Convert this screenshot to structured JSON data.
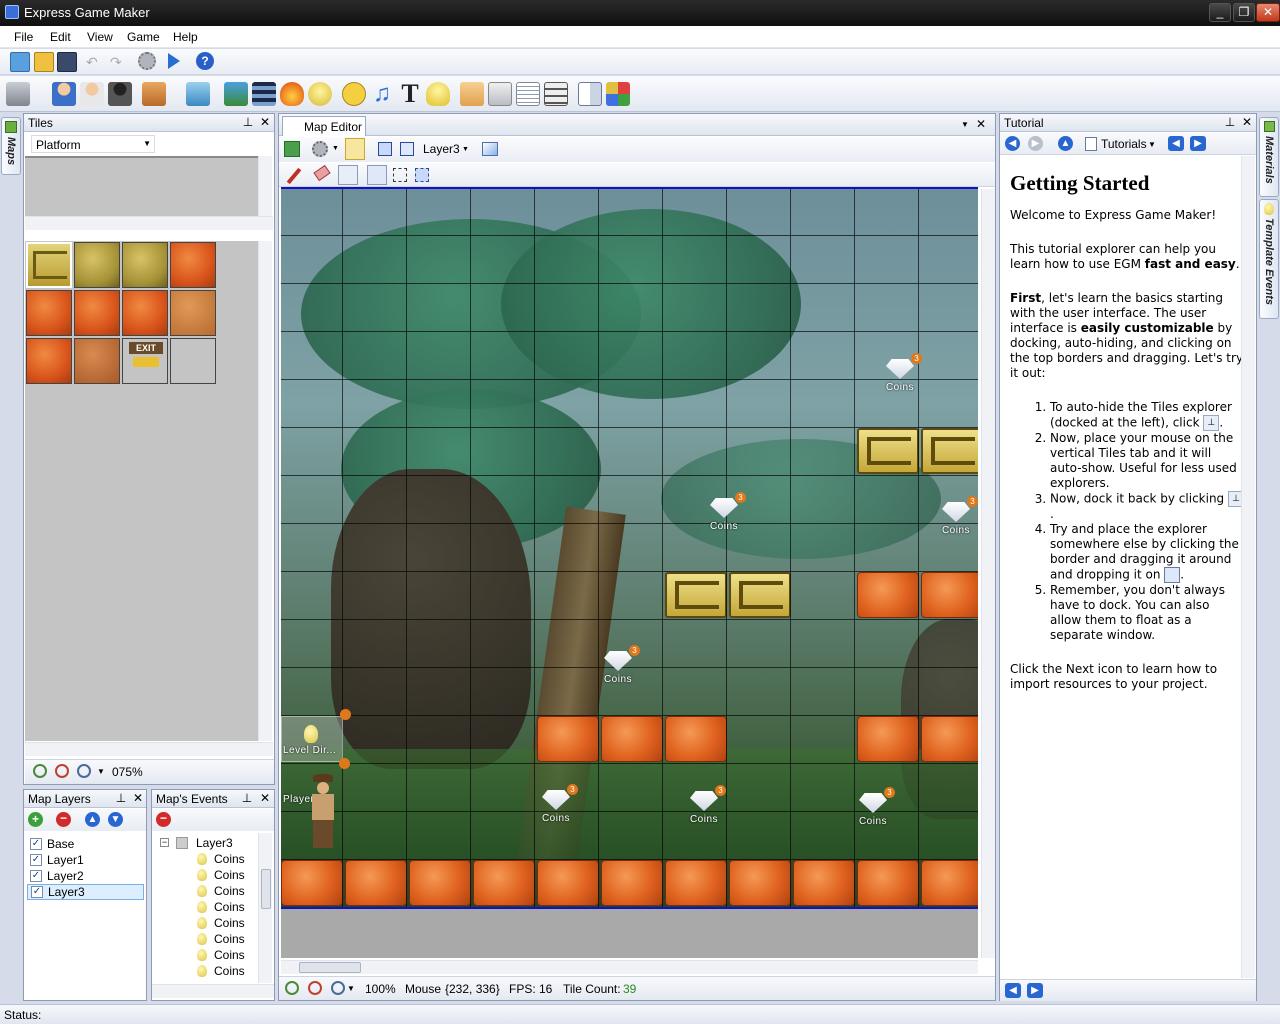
{
  "window": {
    "title": "Express Game Maker"
  },
  "menu": [
    "File",
    "Edit",
    "View",
    "Game",
    "Help"
  ],
  "tiles_panel": {
    "title": "Tiles",
    "tileset_select": "Platform",
    "zoom": "075%"
  },
  "left_tab": {
    "label": "Maps"
  },
  "map_layers": {
    "title": "Map Layers",
    "layers": [
      "Base",
      "Layer1",
      "Layer2",
      "Layer3"
    ]
  },
  "map_events": {
    "title": "Map's Events",
    "root": "Layer3",
    "items": [
      "Coins",
      "Coins",
      "Coins",
      "Coins",
      "Coins",
      "Coins",
      "Coins",
      "Coins"
    ]
  },
  "map_editor": {
    "tab": "Map Editor",
    "layer_select": "Layer3",
    "coin_label": "Coins",
    "coin_badge": "3",
    "level_dir_label": "Level Dir...",
    "player_label": "Player",
    "tile_label": "EXIT",
    "status": {
      "zoom": "100%",
      "mouse_label": "Mouse",
      "mouse_value": "{232, 336}",
      "fps_label": "FPS:",
      "fps_value": "16",
      "tile_count_label": "Tile Count:",
      "tile_count_value": "39"
    }
  },
  "tutorial": {
    "title": "Tutorial",
    "nav_select": "Tutorials",
    "heading": "Getting Started",
    "p1": "Welcome to Express Game Maker!",
    "p2a": "This tutorial explorer can help you learn how to use EGM ",
    "p2b": "fast and easy",
    "p2c": ".",
    "p3a": "First",
    "p3b": ", let's learn the basics starting with the user interface. The user interface is ",
    "p3c": "easily customizable",
    "p3d": " by docking, auto-hiding, and clicking on the top borders and dragging. Let's try it out:",
    "steps": [
      "To auto-hide the Tiles explorer (docked at the left), click",
      "Now, place your mouse on the vertical Tiles tab and it will auto-show. Useful for less used explorers.",
      "Now, dock it back by clicking",
      "Try and place the explorer somewhere else by clicking the border and dragging it around and dropping it on",
      "Remember, you don't always have to dock. You can also allow them to float as a separate window."
    ],
    "footer": "Click the Next icon to learn how to import resources to your project."
  },
  "right_tabs": {
    "materials": "Materials",
    "template_events": "Template Events"
  },
  "statusbar": {
    "label": "Status:"
  },
  "colors": {
    "accent": "#3a6fd8",
    "canvas_border": "#1010c8",
    "tile_count": "#2a8a1a"
  }
}
